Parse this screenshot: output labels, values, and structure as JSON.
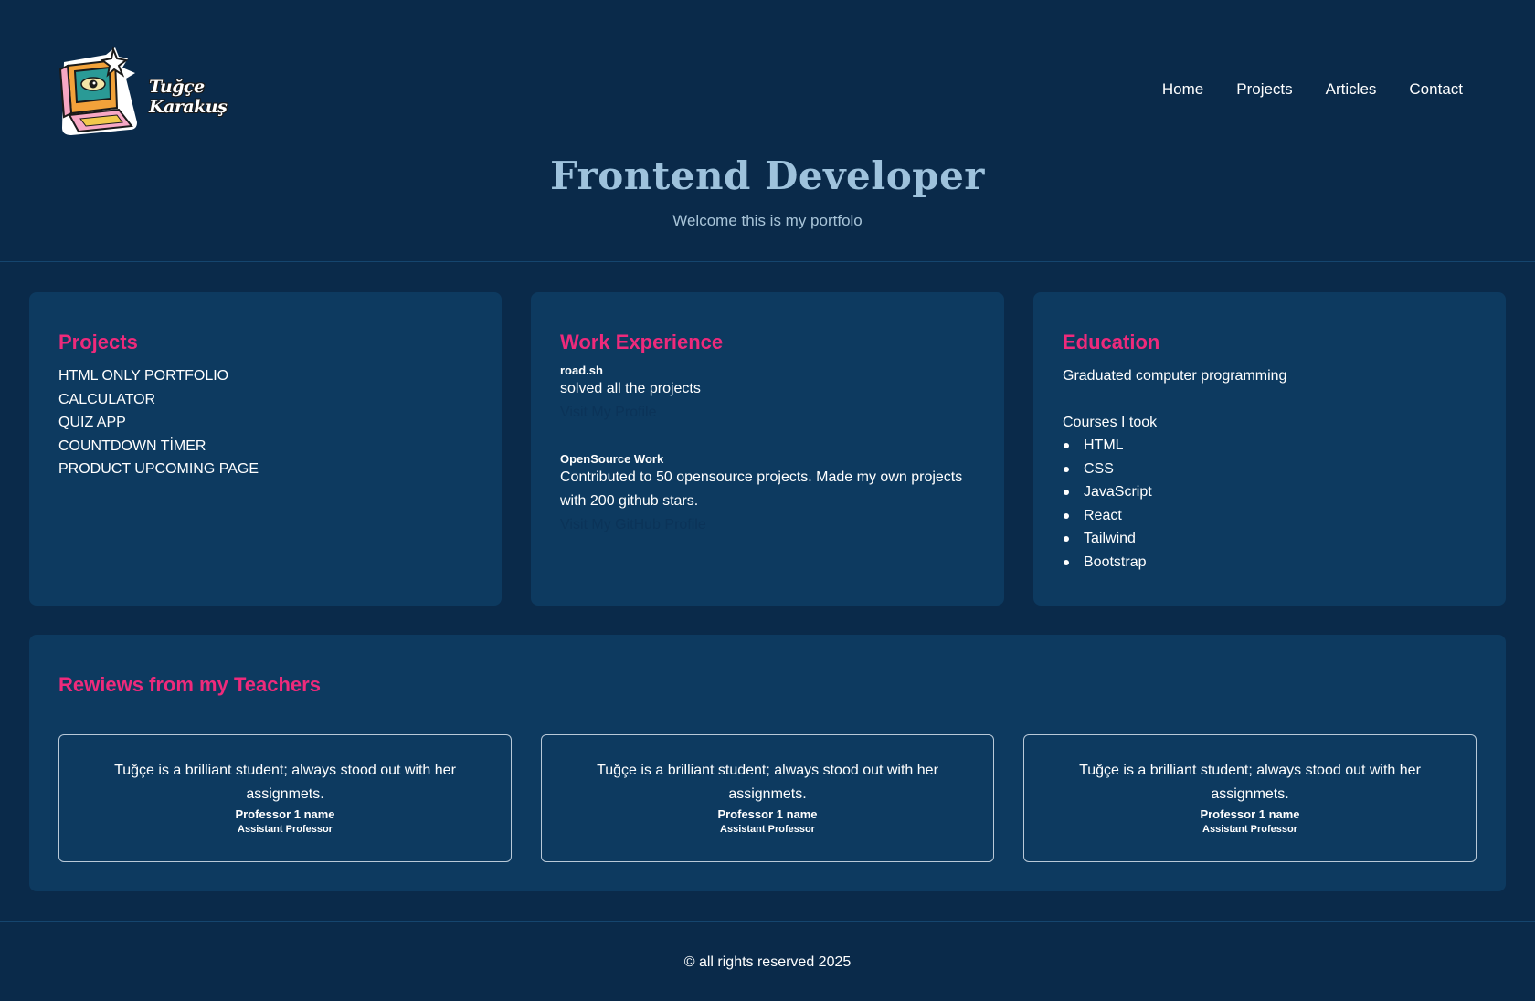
{
  "header": {
    "logo_text": "Tuğçe Karakuş",
    "nav": [
      "Home",
      "Projects",
      "Articles",
      "Contact"
    ],
    "title": "Frontend Developer",
    "subtitle": "Welcome this is my portfolo"
  },
  "projects": {
    "heading": "Projects",
    "items": [
      "HTML ONLY PORTFOLIO",
      "CALCULATOR",
      "QUIZ APP",
      "COUNTDOWN TİMER",
      "PRODUCT UPCOMING PAGE"
    ]
  },
  "work": {
    "heading": "Work Experience",
    "entries": [
      {
        "title": "road.sh",
        "desc": "solved all the projects",
        "link": "Visit My Profile"
      },
      {
        "title": "OpenSource Work",
        "desc": "Contributed to 50 opensource projects. Made my own projects with 200 github stars.",
        "link": "Visit My GitHub Profile"
      }
    ]
  },
  "education": {
    "heading": "Education",
    "degree": "Graduated computer programming",
    "courses_label": "Courses I took",
    "courses": [
      "HTML",
      "CSS",
      "JavaScript",
      "React",
      "Tailwind",
      "Bootstrap"
    ]
  },
  "reviews": {
    "heading": "Rewiews from my Teachers",
    "items": [
      {
        "text": "Tuğçe is a brilliant student; always stood out with her assignmets.",
        "name": "Professor 1 name",
        "role": "Assistant Professor"
      },
      {
        "text": "Tuğçe is a brilliant student; always stood out with her assignmets.",
        "name": "Professor 1 name",
        "role": "Assistant Professor"
      },
      {
        "text": "Tuğçe is a brilliant student; always stood out with her assignmets.",
        "name": "Professor 1 name",
        "role": "Assistant Professor"
      }
    ]
  },
  "footer": {
    "text": "© all rights reserved 2025"
  },
  "colors": {
    "background": "#0a2a4a",
    "card": "#0d3a60",
    "accent": "#ee2a7b",
    "title": "#9ec2dc"
  },
  "icons": {
    "logo": "retro-computer-eye-icon"
  }
}
